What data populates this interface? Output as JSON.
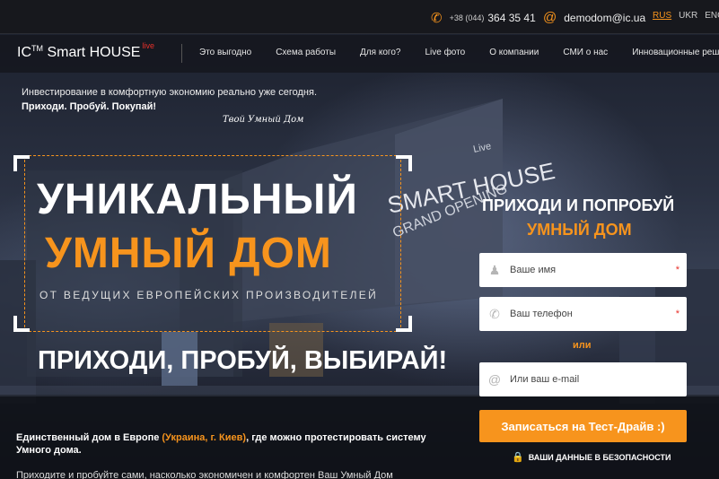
{
  "topbar": {
    "phone_prefix": "+38 (044)",
    "phone_number": "364 35 41",
    "email": "demodom@ic.ua",
    "languages": [
      "RUS",
      "UKR",
      "ENG"
    ],
    "active_language": "RUS"
  },
  "logo": {
    "brand": "IC",
    "tm": "TM",
    "name": "Smart HOUSE",
    "live": "live"
  },
  "nav": [
    "Это выгодно",
    "Схема работы",
    "Для кого?",
    "Live фото",
    "О компании",
    "СМИ о нас",
    "Инновационные решения"
  ],
  "hero": {
    "intro_line1": "Инвестирование в комфортную экономию реально уже сегодня.",
    "intro_line2": "Приходи. Пробуй. Покупай!",
    "signature": "Твой Умный Дом",
    "headline1": "УНИКАЛЬНЫЙ",
    "headline2": "УМНЫЙ ДОМ",
    "subline": "ОТ ВЕДУЩИХ ЕВРОПЕЙСКИХ ПРОИЗВОДИТЕЛЕЙ",
    "cta_line": "ПРИХОДИ, ПРОБУЙ, ВЫБИРАЙ!",
    "building_sign1": "SMART HOUSE",
    "building_sign2": "GRAND OPENING",
    "building_sign3": "Live"
  },
  "description": {
    "part1": "Единственный дом в Европе ",
    "highlight": "(Украина, г. Киев)",
    "part2": ", где можно протестировать систему Умного дома.",
    "line2": "Приходите и пробуйте сами, насколько экономичен и комфортен Ваш Умный Дом"
  },
  "form": {
    "title1": "ПРИХОДИ И ПОПРОБУЙ",
    "title2": "УМНЫЙ ДОМ",
    "name_placeholder": "Ваше имя",
    "phone_placeholder": "Ваш телефон",
    "or_label": "или",
    "email_placeholder": "Или ваш e-mail",
    "required_mark": "*",
    "submit_label": "Записаться на Тест-Драйв :)",
    "security_note": "ВАШИ ДАННЫЕ В БЕЗОПАСНОСТИ"
  },
  "colors": {
    "accent": "#f7941d",
    "required": "#e8302a",
    "topbar": "#17181d"
  },
  "icons": [
    "phone-icon",
    "at-icon",
    "user-icon",
    "phone-handset-icon",
    "at-icon",
    "lock-icon"
  ]
}
